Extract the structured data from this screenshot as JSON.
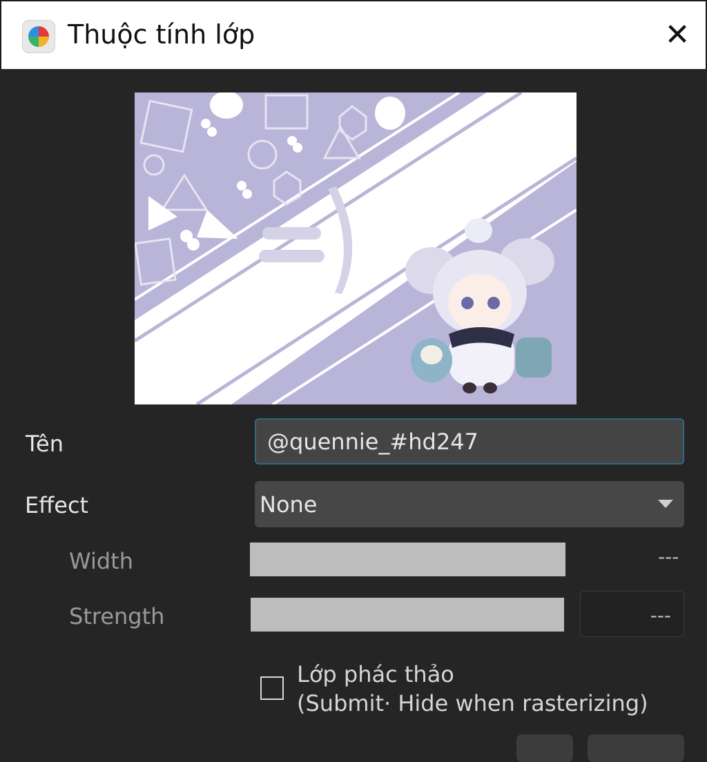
{
  "window": {
    "title": "Thuộc tính lớp",
    "close_glyph": "✕"
  },
  "preview": {
    "alt": "layer thumbnail",
    "colors": {
      "lavender": "#b9b5d8",
      "white": "#ffffff"
    }
  },
  "fields": {
    "name": {
      "label": "Tên",
      "value": "@quennie_#hd247"
    },
    "effect": {
      "label": "Effect",
      "selected": "None"
    },
    "width": {
      "label": "Width",
      "value": "---"
    },
    "strength": {
      "label": "Strength",
      "value": "---"
    }
  },
  "draft": {
    "line1": "Lớp phác thảo",
    "line2": "(Submit· Hide when rasterizing)",
    "checked": false
  },
  "colors": {
    "accent_border": "#2e6a86",
    "background": "#252525"
  }
}
